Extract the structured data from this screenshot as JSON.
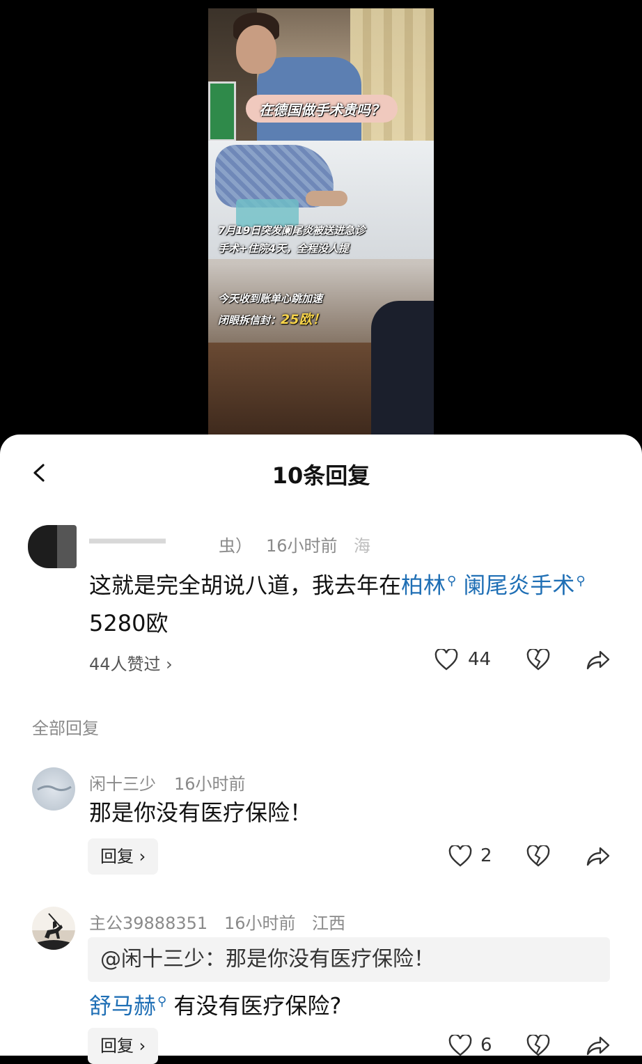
{
  "video": {
    "title_overlay": "在德国做手术贵吗？",
    "caption_line1": "7月19日突发阑尾炎被送进急诊",
    "caption_line2": "手术+住院4天，全程没人提",
    "caption_line3": "今天收到账单心跳加速",
    "caption_line4_prefix": "闭眼拆信封：",
    "caption_line4_amount": "25欧！"
  },
  "header": {
    "title": "10条回复"
  },
  "main_comment": {
    "author_partial": "虫）",
    "time": "16小时前",
    "location_partial": "海",
    "text_prefix": "这就是完全胡说八道，我去年在",
    "link1": "柏林",
    "text_mid": " ",
    "link2": "阑尾炎手术",
    "text_suffix": "5280欧",
    "liked_by": "44人赞过 ›",
    "like_count": "44"
  },
  "section_label": "全部回复",
  "replies": [
    {
      "author": "闲十三少",
      "time": "16小时前",
      "location": "",
      "text": "那是你没有医疗保险！",
      "reply_label": "回复 ›",
      "like_count": "2"
    },
    {
      "author": "主公39888351",
      "time": "16小时前",
      "location": "江西",
      "quote": "@闲十三少：那是你没有医疗保险！",
      "link": "舒马赫",
      "text": "有没有医疗保险?",
      "reply_label": "回复 ›",
      "like_count": "6"
    }
  ]
}
